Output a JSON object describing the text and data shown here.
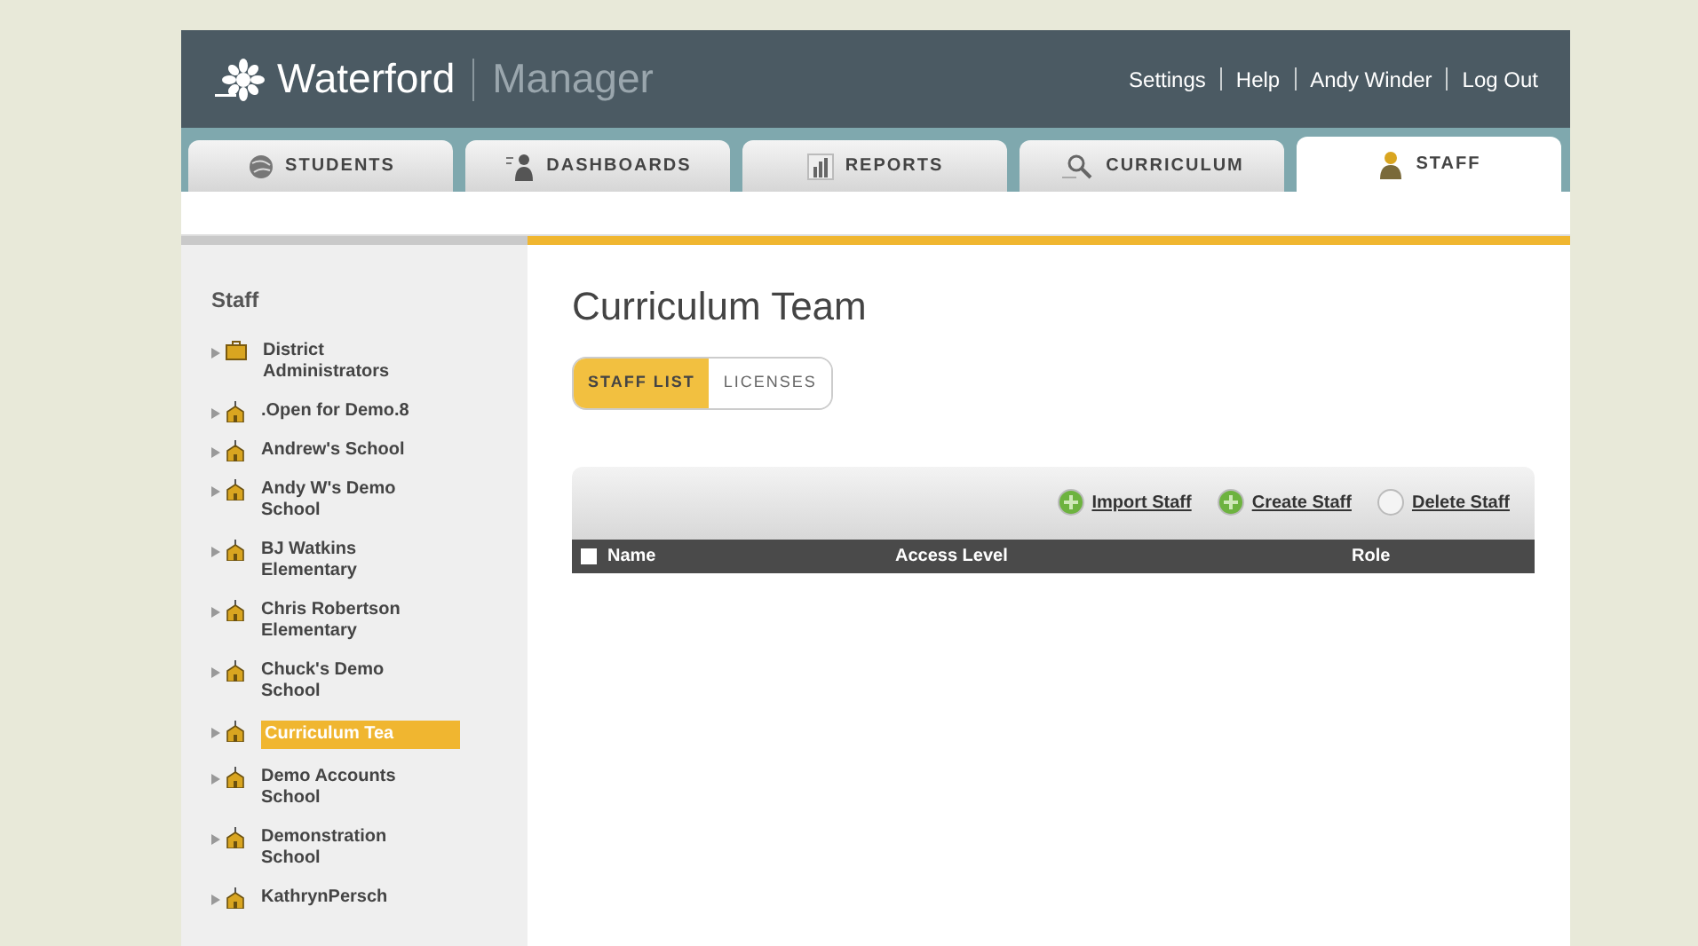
{
  "header": {
    "logo": "Waterford",
    "product": "Manager",
    "links": [
      "Settings",
      "Help",
      "Andy Winder",
      "Log Out"
    ]
  },
  "tabs": [
    {
      "label": "STUDENTS",
      "kind": "students",
      "selected": false
    },
    {
      "label": "DASHBOARDS",
      "kind": "dashboards",
      "selected": false
    },
    {
      "label": "REPORTS",
      "kind": "reports",
      "selected": false
    },
    {
      "label": "CURRICULUM",
      "kind": "curriculum",
      "selected": false
    },
    {
      "label": "STAFF",
      "kind": "staff",
      "selected": true
    }
  ],
  "sidebar": {
    "title": "Staff",
    "items": [
      {
        "label": "District Administrators",
        "kind": "district",
        "selected": false
      },
      {
        "label": ".Open for Demo.8",
        "kind": "school",
        "selected": false
      },
      {
        "label": "Andrew's School",
        "kind": "school",
        "selected": false
      },
      {
        "label": "Andy W's Demo School",
        "kind": "school",
        "selected": false
      },
      {
        "label": "BJ Watkins Elementary",
        "kind": "school",
        "selected": false
      },
      {
        "label": "Chris Robertson Elementary",
        "kind": "school",
        "selected": false
      },
      {
        "label": "Chuck's Demo School",
        "kind": "school",
        "selected": false
      },
      {
        "label": "Curriculum Tea",
        "kind": "school",
        "selected": true
      },
      {
        "label": "Demo Accounts School",
        "kind": "school",
        "selected": false
      },
      {
        "label": "Demonstration School",
        "kind": "school",
        "selected": false
      },
      {
        "label": "KathrynPersch",
        "kind": "school",
        "selected": false
      }
    ]
  },
  "main": {
    "title": "Curriculum Team",
    "subtabs": [
      {
        "label": "STAFF LIST",
        "selected": true
      },
      {
        "label": "LICENSES",
        "selected": false
      }
    ],
    "actions": [
      {
        "label": "Import Staff",
        "kind": "import"
      },
      {
        "label": "Create Staff",
        "kind": "create"
      },
      {
        "label": "Delete Staff",
        "kind": "delete"
      }
    ],
    "table": {
      "select_all": {
        "checked": false
      },
      "columns": [
        "Name",
        "Access Level",
        "Role"
      ]
    }
  }
}
